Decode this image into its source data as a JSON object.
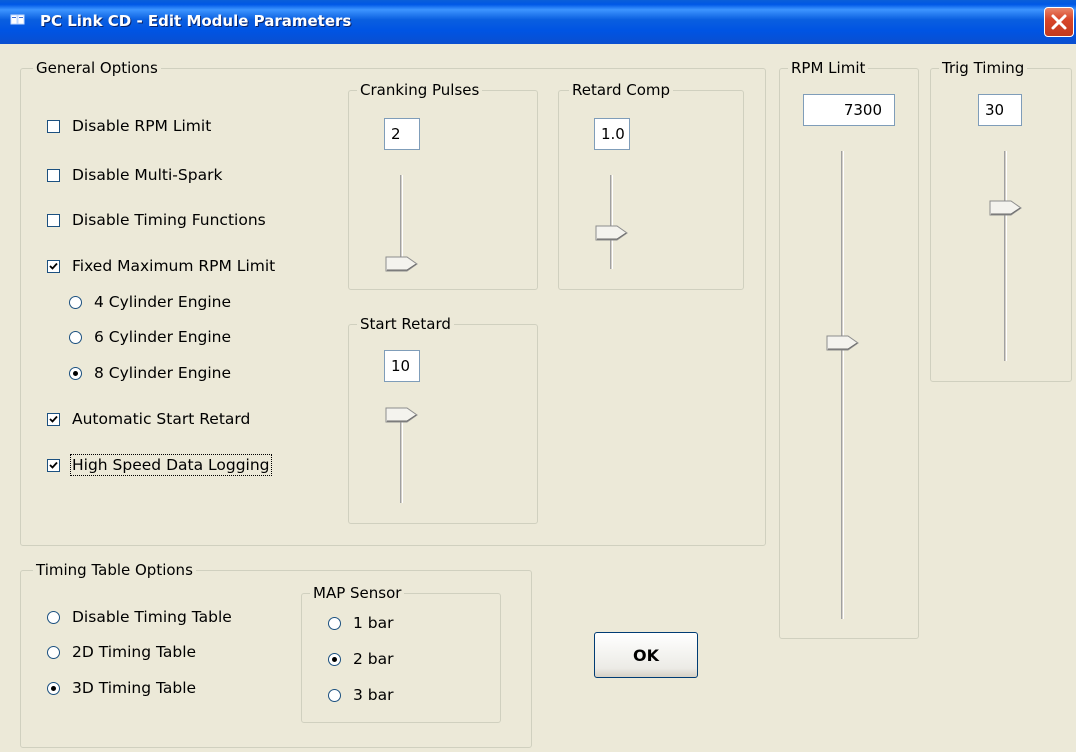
{
  "window": {
    "title": "PC Link CD - Edit Module Parameters",
    "title_icon": "app-icon",
    "close_icon": "close-icon",
    "colors": {
      "titlebar": "#0054e3",
      "close": "#d8462a",
      "face": "#ece9d8"
    }
  },
  "general_options": {
    "label": "General Options",
    "disable_rpm_limit": {
      "label": "Disable RPM Limit",
      "checked": false
    },
    "disable_multi_spark": {
      "label": "Disable Multi-Spark",
      "checked": false
    },
    "disable_timing_functions": {
      "label": "Disable Timing Functions",
      "checked": false
    },
    "fixed_max_rpm_limit": {
      "label": "Fixed Maximum RPM Limit",
      "checked": true
    },
    "cylinders": [
      {
        "label": "4 Cylinder Engine",
        "selected": false
      },
      {
        "label": "6 Cylinder Engine",
        "selected": false
      },
      {
        "label": "8 Cylinder Engine",
        "selected": true
      }
    ],
    "automatic_start_retard": {
      "label": "Automatic Start Retard",
      "checked": true
    },
    "high_speed_data_logging": {
      "label": "High Speed Data Logging",
      "checked": true
    }
  },
  "cranking_pulses": {
    "label": "Cranking Pulses",
    "value": "2",
    "slider_fraction": 0.95
  },
  "retard_comp": {
    "label": "Retard Comp",
    "value": "1.0",
    "slider_fraction": 0.62
  },
  "start_retard": {
    "label": "Start Retard",
    "value": "10",
    "slider_fraction": 0.0
  },
  "rpm_limit": {
    "label": "RPM Limit",
    "value": "7300",
    "slider_fraction": 0.41
  },
  "trig_timing": {
    "label": "Trig Timing",
    "value": "30",
    "slider_fraction": 0.27
  },
  "timing_table": {
    "label": "Timing Table Options",
    "options": [
      {
        "label": "Disable Timing Table",
        "selected": false
      },
      {
        "label": "2D Timing Table",
        "selected": false
      },
      {
        "label": "3D Timing Table",
        "selected": true
      }
    ]
  },
  "map_sensor": {
    "label": "MAP Sensor",
    "options": [
      {
        "label": "1 bar",
        "selected": false
      },
      {
        "label": "2 bar",
        "selected": true
      },
      {
        "label": "3 bar",
        "selected": false
      }
    ]
  },
  "ok_button": {
    "label": "OK"
  }
}
